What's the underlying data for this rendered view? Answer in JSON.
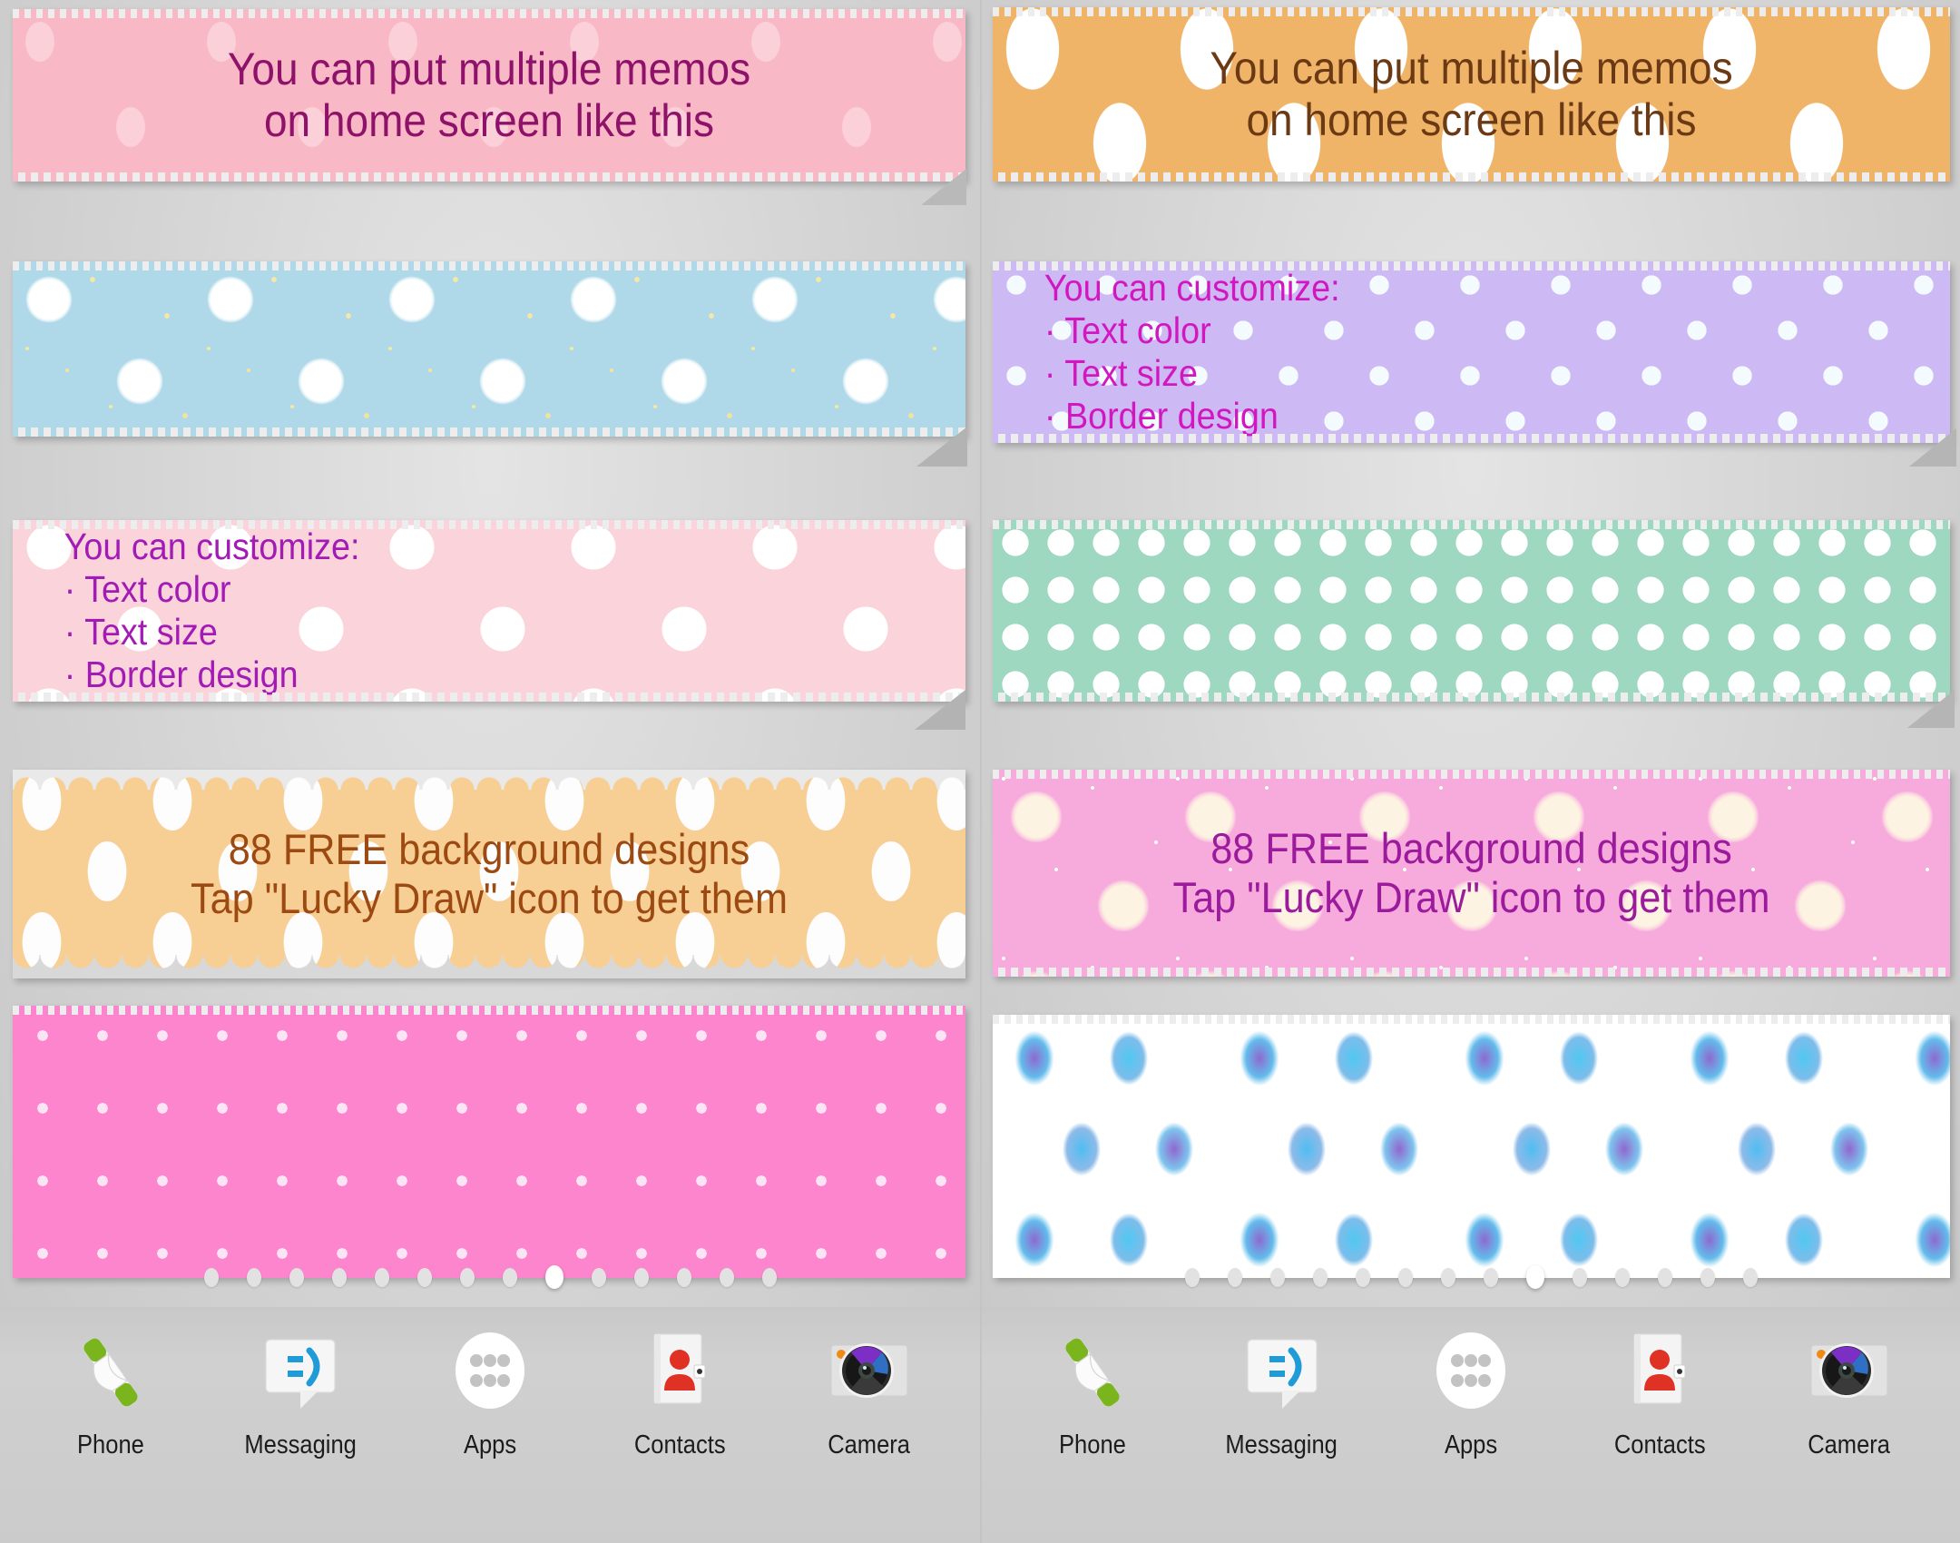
{
  "screen": {
    "description": "Android home screen showing multiple sticky-memo widgets, two variants side by side"
  },
  "memos": {
    "left": [
      {
        "id": "memo-l1",
        "text": "You can put multiple memos\non home screen like this",
        "text_color": "#8e1269",
        "bg_color": "#f9b8c6",
        "pattern": "pink-oval-dots",
        "font_size": 50,
        "align": "center"
      },
      {
        "id": "memo-l2",
        "text": "",
        "text_color": "#444444",
        "bg_color": "#afd9e8",
        "pattern": "blue-fluffy-dots-yellow-speckles",
        "font_size": 44,
        "align": "center"
      },
      {
        "id": "memo-l3",
        "text": "You can customize:\n· Text color\n· Text size\n· Border design",
        "text_color": "#a31bb5",
        "bg_color": "#fbd3da",
        "pattern": "pink-white-polkadots",
        "font_size": 41,
        "align": "left"
      },
      {
        "id": "memo-l4",
        "text": "88 FREE background designs\nTap \"Lucky Draw\" icon to get them",
        "text_color": "#9c4a12",
        "bg_color": "#f7cf95",
        "pattern": "orange-white-ovals-scalloped",
        "font_size": 47,
        "align": "center"
      },
      {
        "id": "memo-l5",
        "text": "",
        "text_color": "#ffffff",
        "bg_color": "#fd85cd",
        "pattern": "hotpink-tiny-white-dots",
        "font_size": 40,
        "align": "center"
      }
    ],
    "right": [
      {
        "id": "memo-r1",
        "text": "You can put multiple memos\non home screen like this",
        "text_color": "#6b3a14",
        "bg_color": "#f0b469",
        "pattern": "orange-big-white-ovals",
        "font_size": 50,
        "align": "center"
      },
      {
        "id": "memo-r2",
        "text": "You can customize:\n· Text color\n· Text size\n· Border design",
        "text_color": "#d317c0",
        "bg_color": "#cdb9f4",
        "pattern": "lavender-white-dots",
        "font_size": 41,
        "align": "left"
      },
      {
        "id": "memo-r3",
        "text": "",
        "text_color": "#336655",
        "bg_color": "#9ed8c0",
        "pattern": "mint-white-polkadots",
        "font_size": 40,
        "align": "center"
      },
      {
        "id": "memo-r4",
        "text": "88 FREE background designs\nTap \"Lucky Draw\" icon to get them",
        "text_color": "#9c1b9c",
        "bg_color": "#f7aadc",
        "pattern": "pink-cream-fluffy-dots",
        "font_size": 47,
        "align": "center"
      },
      {
        "id": "memo-r5",
        "text": "",
        "text_color": "#2b5fa8",
        "bg_color": "#ffffff",
        "pattern": "watercolor-blue-purple-ovals",
        "font_size": 40,
        "align": "center"
      }
    ]
  },
  "page_indicator": {
    "total": 14,
    "active_index": 8
  },
  "dock": {
    "items": [
      {
        "label": "Phone",
        "icon": "phone-handset-icon"
      },
      {
        "label": "Messaging",
        "icon": "speech-bubble-smiley-icon"
      },
      {
        "label": "Apps",
        "icon": "app-drawer-grid-icon"
      },
      {
        "label": "Contacts",
        "icon": "contact-person-card-icon"
      },
      {
        "label": "Camera",
        "icon": "camera-lens-icon"
      }
    ]
  },
  "colors": {
    "wallpaper": "#d3d3d3",
    "dock_bg": "#cbcbcb",
    "page_dot_inactive": "#e2e2e2",
    "page_dot_active": "#ffffff",
    "dock_label": "#1c1c1c"
  }
}
